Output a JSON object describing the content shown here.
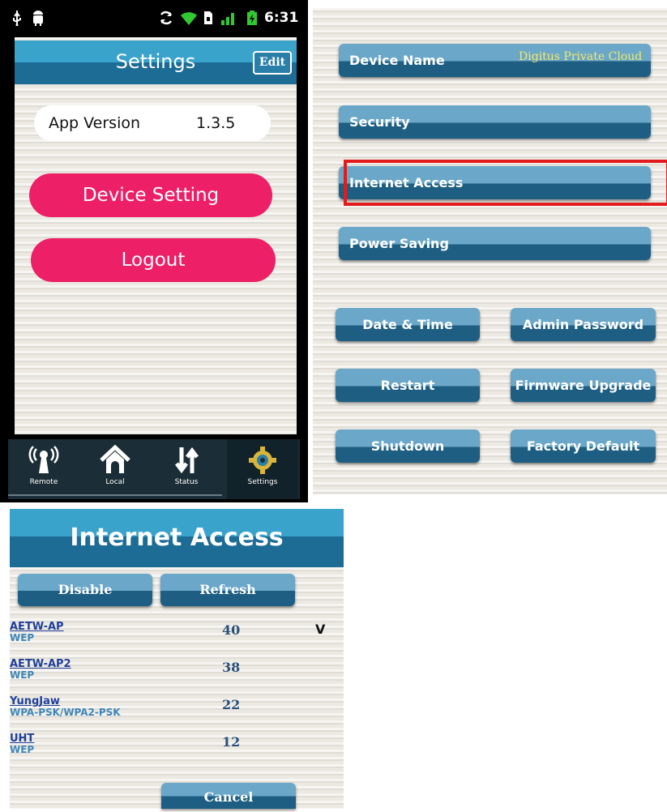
{
  "phone": {
    "status_bar": {
      "time": "6:31"
    },
    "header": {
      "title": "Settings",
      "edit_label": "Edit"
    },
    "app_version": {
      "label": "App Version",
      "value": "1.3.5"
    },
    "device_setting_label": "Device Setting",
    "logout_label": "Logout",
    "tabs": [
      {
        "label": "Remote",
        "icon": "remote-signal-icon"
      },
      {
        "label": "Local",
        "icon": "home-icon"
      },
      {
        "label": "Status",
        "icon": "transfer-arrows-icon"
      },
      {
        "label": "Settings",
        "icon": "gear-icon"
      }
    ],
    "accent_color": "#ec1f67"
  },
  "device_settings": {
    "device_name": {
      "label": "Device Name",
      "value": "Digitus Private Cloud"
    },
    "security_label": "Security",
    "internet_access_label": "Internet Access",
    "power_saving_label": "Power Saving",
    "buttons": {
      "date_time": "Date & Time",
      "admin_password": "Admin Password",
      "restart": "Restart",
      "firmware_upgrade": "Firmware Upgrade",
      "shutdown": "Shutdown",
      "factory_default": "Factory Default"
    },
    "highlight_color": "#e21c1c"
  },
  "internet_access": {
    "title": "Internet Access",
    "disable_label": "Disable",
    "refresh_label": "Refresh",
    "cancel_label": "Cancel",
    "networks": [
      {
        "ssid": "AETW-AP",
        "security": "WEP",
        "signal": "40",
        "connected": "V"
      },
      {
        "ssid": "AETW-AP2",
        "security": "WEP",
        "signal": "38",
        "connected": ""
      },
      {
        "ssid": "YungJaw",
        "security": "WPA-PSK/WPA2-PSK",
        "signal": "22",
        "connected": ""
      },
      {
        "ssid": "UHT",
        "security": "WEP",
        "signal": "12",
        "connected": ""
      }
    ]
  }
}
